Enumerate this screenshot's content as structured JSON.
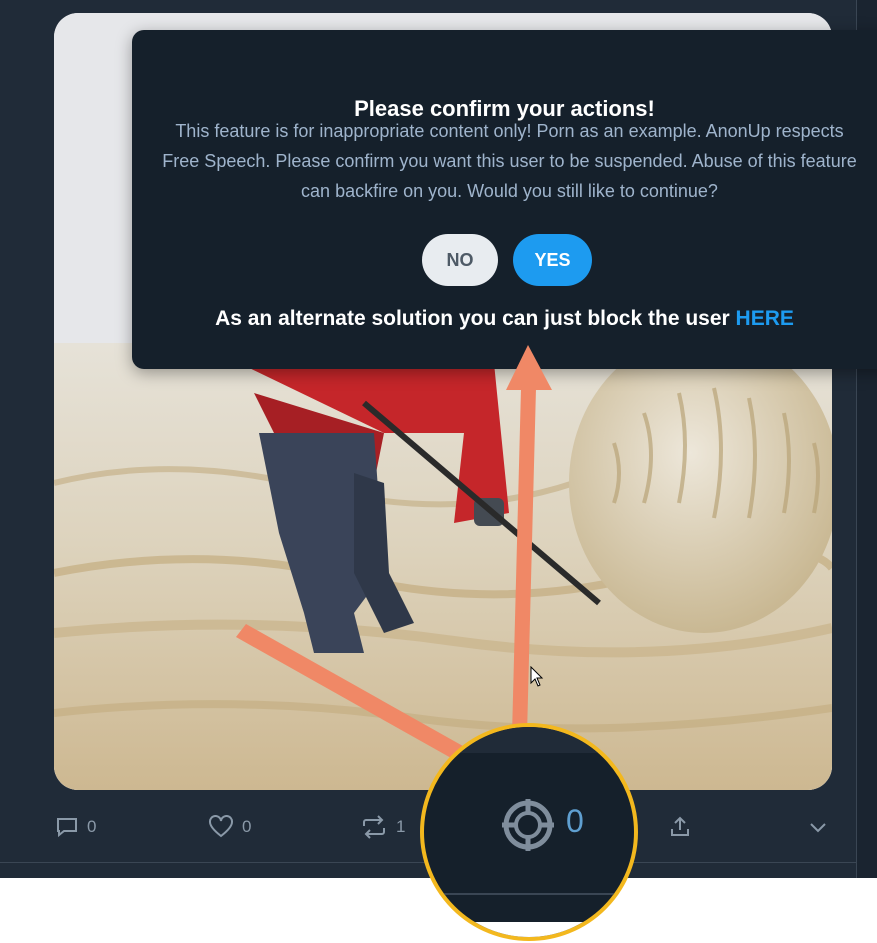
{
  "modal": {
    "title": "Please confirm your actions!",
    "body": "This feature is for inappropriate content only! Porn as an example. AnonUp respects Free Speech. Please confirm you want this user to be suspended. Abuse of this feature can backfire on you. Would you still like to continue?",
    "no_label": "NO",
    "yes_label": "YES",
    "alternate_text": "As an alternate solution you can just block the user",
    "alternate_link": "HERE"
  },
  "actions": {
    "reply_count": "0",
    "like_count": "0",
    "repost_count": "1",
    "report_count": "0"
  },
  "icons": [
    "reply-icon",
    "like-icon",
    "repost-icon",
    "report-target-icon",
    "share-icon",
    "chevron-down-icon",
    "cursor-icon"
  ],
  "colors": {
    "background": "#202b38",
    "modal": "#15202b",
    "accent": "#1d9bf0",
    "arrow": "#f08866",
    "magnifier_ring": "#f3b81e"
  }
}
